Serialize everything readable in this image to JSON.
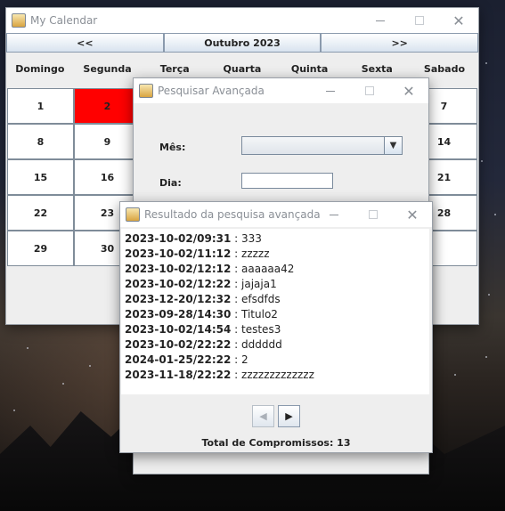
{
  "calendar": {
    "title": "My Calendar",
    "prev_label": "<<",
    "month_label": "Outubro 2023",
    "next_label": ">>",
    "day_headers": [
      "Domingo",
      "Segunda",
      "Terça",
      "Quarta",
      "Quinta",
      "Sexta",
      "Sabado"
    ],
    "visible_days": [
      "1",
      "2",
      "7",
      "8",
      "9",
      "14",
      "15",
      "16",
      "21",
      "22",
      "23",
      "28",
      "29",
      "30"
    ],
    "today": "2",
    "today_color": "#ff0000"
  },
  "search_dialog": {
    "title": "Pesquisar Avançada",
    "month_label": "Mês:",
    "month_value": "",
    "day_label": "Dia:",
    "day_value": ""
  },
  "results_dialog": {
    "title": "Resultado da pesquisa avançada",
    "items": [
      {
        "datetime": "2023-10-02/09:31",
        "text": "333"
      },
      {
        "datetime": "2023-10-02/11:12",
        "text": "zzzzz"
      },
      {
        "datetime": "2023-10-02/12:12",
        "text": "aaaaaa42"
      },
      {
        "datetime": "2023-10-02/12:22",
        "text": "jajaja1"
      },
      {
        "datetime": "2023-12-20/12:32",
        "text": "efsdfds"
      },
      {
        "datetime": "2023-09-28/14:30",
        "text": "Titulo2"
      },
      {
        "datetime": "2023-10-02/14:54",
        "text": "testes3"
      },
      {
        "datetime": "2023-10-02/22:22",
        "text": "dddddd"
      },
      {
        "datetime": "2024-01-25/22:22",
        "text": "2"
      },
      {
        "datetime": "2023-11-18/22:22",
        "text": "zzzzzzzzzzzzz"
      }
    ],
    "separator": " : ",
    "prev_page_icon": "◀",
    "next_page_icon": "▶",
    "total_label": "Total de Compromissos: 13"
  }
}
